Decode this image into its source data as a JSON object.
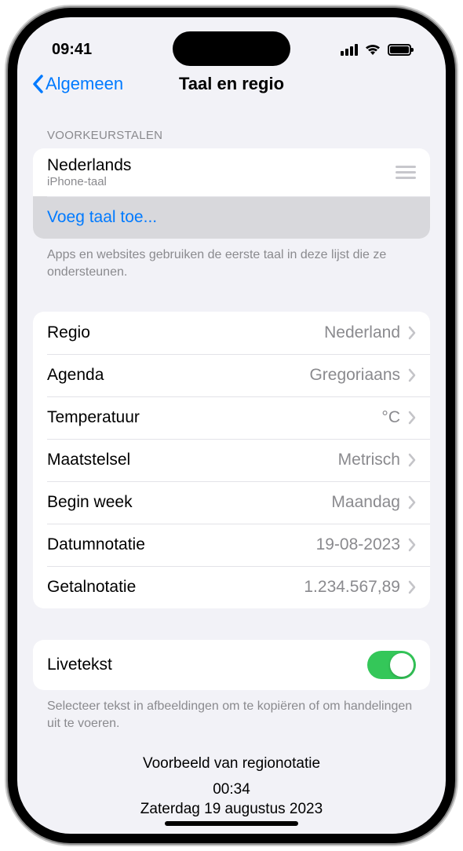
{
  "status": {
    "time": "09:41"
  },
  "nav": {
    "back": "Algemeen",
    "title": "Taal en regio"
  },
  "preferred": {
    "header": "VOORKEURSTALEN",
    "lang_name": "Nederlands",
    "lang_sub": "iPhone-taal",
    "add": "Voeg taal toe...",
    "footer": "Apps en websites gebruiken de eerste taal in deze lijst die ze ondersteunen."
  },
  "settings": [
    {
      "label": "Regio",
      "value": "Nederland"
    },
    {
      "label": "Agenda",
      "value": "Gregoriaans"
    },
    {
      "label": "Temperatuur",
      "value": "°C"
    },
    {
      "label": "Maatstelsel",
      "value": "Metrisch"
    },
    {
      "label": "Begin week",
      "value": "Maandag"
    },
    {
      "label": "Datumnotatie",
      "value": "19-08-2023"
    },
    {
      "label": "Getalnotatie",
      "value": "1.234.567,89"
    }
  ],
  "livetext": {
    "label": "Livetekst",
    "footer": "Selecteer tekst in afbeeldingen om te kopiëren of om handelingen uit te voeren.",
    "enabled": true
  },
  "preview": {
    "title": "Voorbeeld van regionotatie",
    "time": "00:34",
    "date": "Zaterdag 19 augustus 2023"
  }
}
